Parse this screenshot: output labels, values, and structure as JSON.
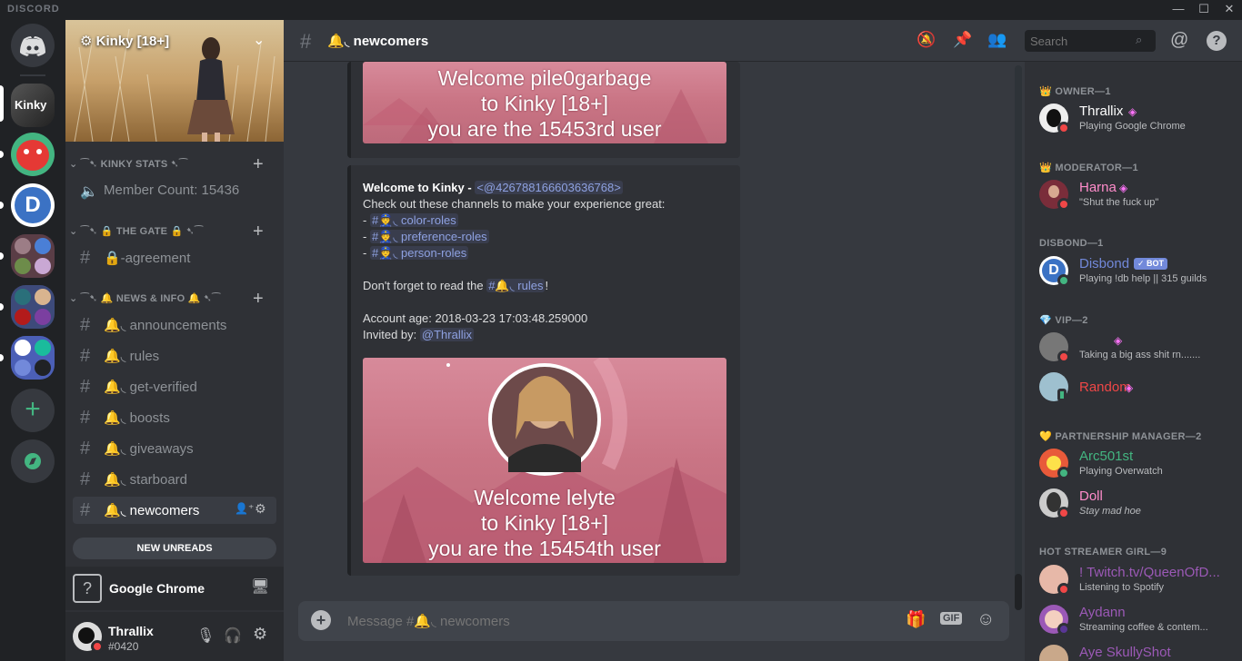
{
  "window": {
    "brand": "DISCORD"
  },
  "server": {
    "name": "Kinky [18+]",
    "categories": [
      {
        "label": "⁀➷ KINKY STATS ➷⁀"
      },
      {
        "label": "⁀➷ 🔒 THE GATE 🔒 ➷⁀"
      },
      {
        "label": "⁀➷ 🔔 NEWS & INFO 🔔 ➷⁀"
      }
    ],
    "stat_channel": "Member Count: 15436",
    "gate_channel": "🔒-agreement",
    "news_channels": [
      "🔔◟ announcements",
      "🔔◟ rules",
      "🔔◟ get-verified",
      "🔔◟ boosts",
      "🔔◟ giveaways",
      "🔔◟ starboard",
      "🔔◟ newcomers"
    ],
    "new_unreads": "NEW UNREADS"
  },
  "activity": {
    "label": "Google Chrome"
  },
  "user": {
    "name": "Thrallix",
    "tag": "#0420"
  },
  "chat": {
    "channel": "🔔◟ newcomers",
    "search_placeholder": "Search",
    "composer_placeholder": "Message #🔔◟ newcomers",
    "gif_label": "GIF",
    "embed1": {
      "line1": "Welcome pile0garbage",
      "line2": "to Kinky [18+]",
      "line3": "you are the 15453rd user"
    },
    "message": {
      "title": "Welcome to Kinky -",
      "mention": "<@426788166603636768>",
      "line1": "Check out these channels to make your experience great:",
      "links": [
        "#👮◟ color-roles",
        "#👮◟ preference-roles",
        "#👮◟ person-roles"
      ],
      "rules_prefix": "Don't forget to read the",
      "rules_link": "#🔔◟ rules",
      "rules_suffix": "!",
      "account_age": "Account age: 2018-03-23 17:03:48.259000",
      "invited_prefix": "Invited by:",
      "invited_by": "@Thrallix"
    },
    "embed2": {
      "line1": "Welcome lelyte",
      "line2": "to Kinky [18+]",
      "line3": "you are the 15454th user"
    }
  },
  "members": {
    "groups": [
      {
        "header": "👑 OWNER—1"
      },
      {
        "header": "👑 MODERATOR—1"
      },
      {
        "header": "DISBOND—1"
      },
      {
        "header": "💎 VIP—2"
      },
      {
        "header": "💛 PARTNERSHIP MANAGER—2"
      },
      {
        "header": "HOT STREAMER GIRL—9"
      }
    ],
    "list": [
      {
        "name": "Thrallix",
        "activity": "Playing Google Chrome",
        "color": "#ffffff"
      },
      {
        "name": "Harna",
        "activity": "\"Shut the fuck up\"",
        "color": "#ff8ccb"
      },
      {
        "name": "Disbond",
        "badge": "✓ BOT",
        "activity": "Playing !db help || 315 guilds",
        "color": "#7289da"
      },
      {
        "name": "",
        "activity": "Taking a big ass shit rn.......",
        "color": "#7289da"
      },
      {
        "name": "Random",
        "activity": "",
        "color": "#f04747"
      },
      {
        "name": "Arc501st",
        "activity": "Playing Overwatch",
        "color": "#43b581"
      },
      {
        "name": "Doll",
        "activity": "Stay mad hoe",
        "color": "#ff8ccb"
      },
      {
        "name": "! Twitch.tv/QueenOfD...",
        "activity": "Listening to Spotify",
        "color": "#9b59b6"
      },
      {
        "name": "Aydann",
        "activity": "Streaming coffee & contem...",
        "color": "#9b59b6"
      },
      {
        "name": "Aye SkullyShot",
        "activity": "",
        "color": "#9b59b6"
      }
    ]
  },
  "colors": {
    "accent": "#7289da",
    "online": "#43b581",
    "dnd": "#f04747",
    "bg": "#36393f"
  }
}
